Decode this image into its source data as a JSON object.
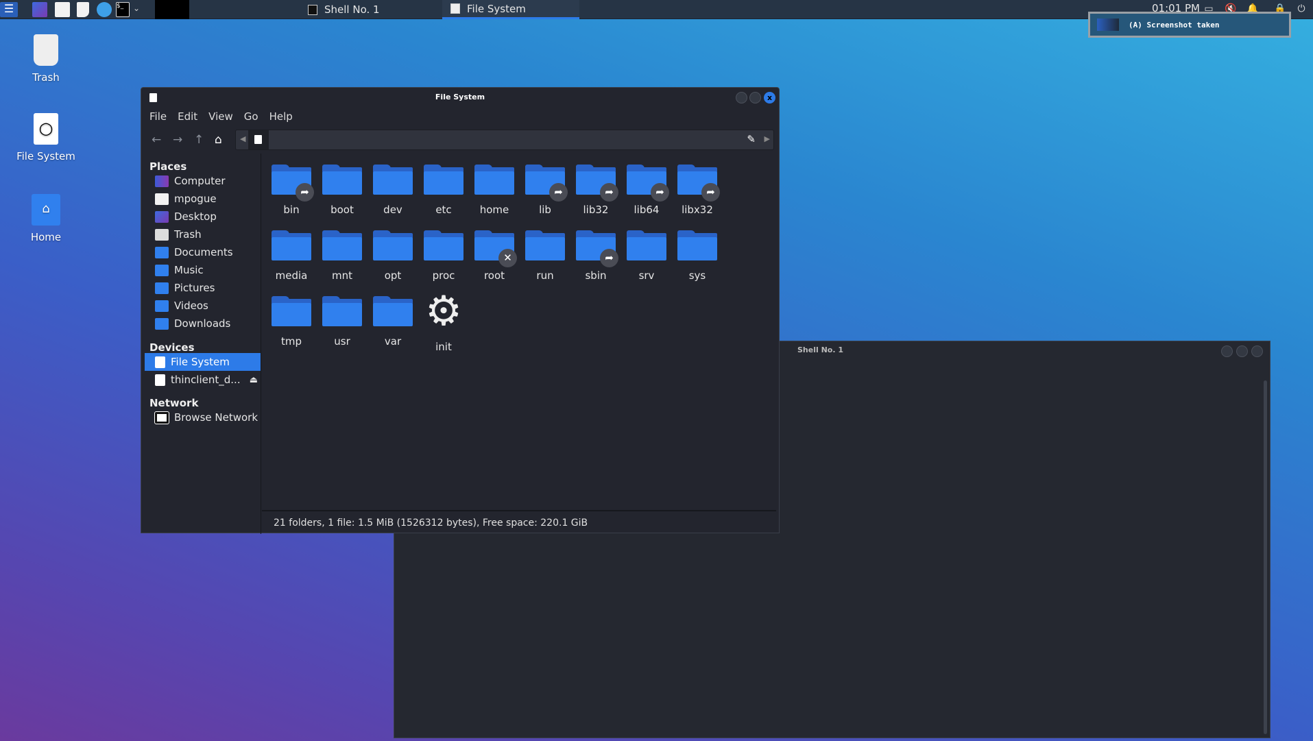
{
  "taskbar": {
    "launchers": [
      "kali-menu-icon",
      "desktop-icon",
      "files-icon",
      "text-editor-icon",
      "browser-icon",
      "terminal-icon"
    ],
    "tasks": [
      {
        "label": "Shell No. 1",
        "active": false
      },
      {
        "label": "File System",
        "active": true
      }
    ],
    "clock": "01:01 PM",
    "tray": [
      "network-icon",
      "mute-icon",
      "bell-icon",
      "lock-icon",
      "logout-icon"
    ]
  },
  "notification": {
    "text": "(A) Screenshot taken"
  },
  "desktop": {
    "icons": [
      {
        "label": "Trash"
      },
      {
        "label": "File System"
      },
      {
        "label": "Home"
      }
    ]
  },
  "shell": {
    "title": "Shell No. 1"
  },
  "file_manager": {
    "title": "File System",
    "menu": [
      "File",
      "Edit",
      "View",
      "Go",
      "Help"
    ],
    "sidebar": {
      "places_heading": "Places",
      "places": [
        "Computer",
        "mpogue",
        "Desktop",
        "Trash",
        "Documents",
        "Music",
        "Pictures",
        "Videos",
        "Downloads"
      ],
      "devices_heading": "Devices",
      "devices": [
        "File System",
        "thinclient_d..."
      ],
      "network_heading": "Network",
      "network": [
        "Browse Network"
      ]
    },
    "items": [
      {
        "name": "bin",
        "type": "folder",
        "badge": "link"
      },
      {
        "name": "boot",
        "type": "folder"
      },
      {
        "name": "dev",
        "type": "folder"
      },
      {
        "name": "etc",
        "type": "folder"
      },
      {
        "name": "home",
        "type": "folder"
      },
      {
        "name": "lib",
        "type": "folder",
        "badge": "link"
      },
      {
        "name": "lib32",
        "type": "folder",
        "badge": "link"
      },
      {
        "name": "lib64",
        "type": "folder",
        "badge": "link"
      },
      {
        "name": "libx32",
        "type": "folder",
        "badge": "link"
      },
      {
        "name": "media",
        "type": "folder"
      },
      {
        "name": "mnt",
        "type": "folder"
      },
      {
        "name": "opt",
        "type": "folder"
      },
      {
        "name": "proc",
        "type": "folder"
      },
      {
        "name": "root",
        "type": "folder",
        "badge": "no-access"
      },
      {
        "name": "run",
        "type": "folder"
      },
      {
        "name": "sbin",
        "type": "folder",
        "badge": "link"
      },
      {
        "name": "srv",
        "type": "folder"
      },
      {
        "name": "sys",
        "type": "folder"
      },
      {
        "name": "tmp",
        "type": "folder"
      },
      {
        "name": "usr",
        "type": "folder"
      },
      {
        "name": "var",
        "type": "folder"
      },
      {
        "name": "init",
        "type": "file"
      }
    ],
    "status": "21 folders, 1 file: 1.5  MiB (1526312 bytes), Free space: 220.1  GiB"
  },
  "colors": {
    "accent": "#2d7be8",
    "folder": "#3080ee",
    "window_bg": "#23252e"
  }
}
